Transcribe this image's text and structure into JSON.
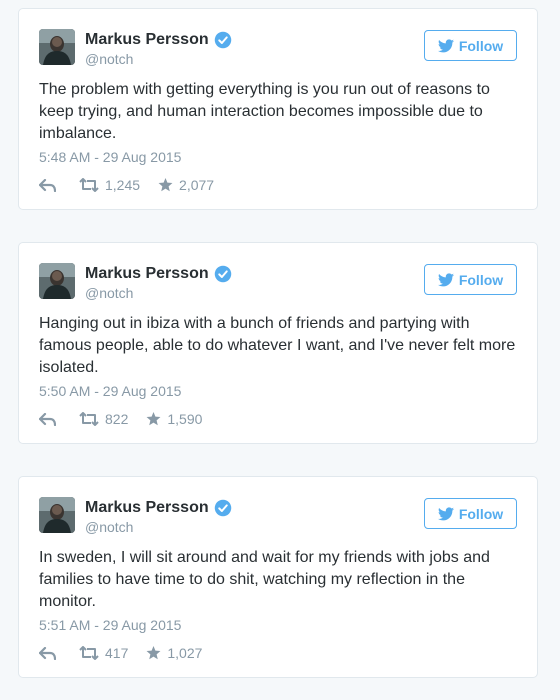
{
  "theme": {
    "accent": "#55acee",
    "text": "#292f33",
    "muted": "#8899a6",
    "border": "#e1e8ed",
    "background": "#f5f8fa"
  },
  "tweets": [
    {
      "author_name": "Markus Persson",
      "handle": "@notch",
      "verified": true,
      "follow_label": "Follow",
      "text": "The problem with getting everything is you run out of reasons to keep trying, and human interaction becomes impossible due to imbalance.",
      "timestamp": "5:48 AM - 29 Aug 2015",
      "retweets": "1,245",
      "favorites": "2,077"
    },
    {
      "author_name": "Markus Persson",
      "handle": "@notch",
      "verified": true,
      "follow_label": "Follow",
      "text": "Hanging out in ibiza with a bunch of friends and partying with famous people, able to do whatever I want, and I've never felt more isolated.",
      "timestamp": "5:50 AM - 29 Aug 2015",
      "retweets": "822",
      "favorites": "1,590"
    },
    {
      "author_name": "Markus Persson",
      "handle": "@notch",
      "verified": true,
      "follow_label": "Follow",
      "text": "In sweden, I will sit around and wait for my friends with jobs and families to have time to do shit, watching my reflection in the monitor.",
      "timestamp": "5:51 AM - 29 Aug 2015",
      "retweets": "417",
      "favorites": "1,027"
    }
  ]
}
